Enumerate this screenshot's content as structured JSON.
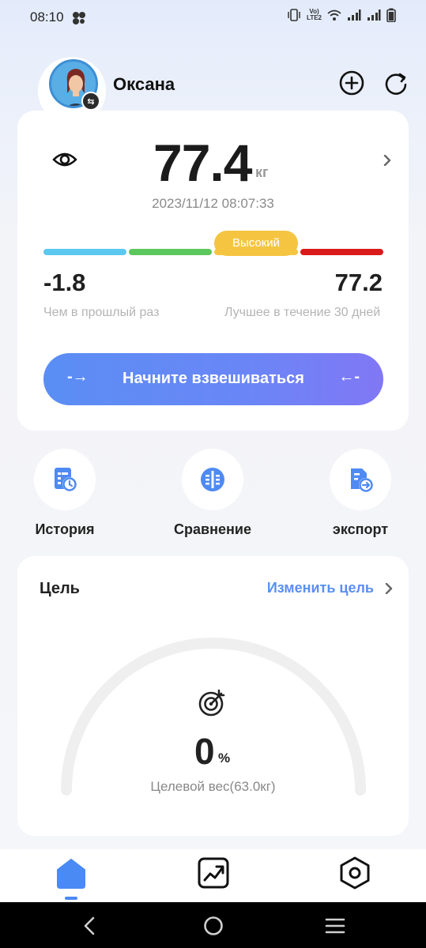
{
  "status_bar": {
    "time": "08:10",
    "network_label_top": "Vo)",
    "network_label_bottom": "LTE2",
    "icons": [
      "app-cluster-icon",
      "vibrate-icon",
      "wifi-icon",
      "signal-icon",
      "signal-icon",
      "battery-icon"
    ]
  },
  "header": {
    "user_name": "Оксана",
    "add_icon": "plus-circle-icon",
    "sync_icon": "refresh-icon"
  },
  "weight": {
    "value": "77.4",
    "unit": "кг",
    "datetime": "2023/11/12 08:07:33",
    "level_badge": "Высокий",
    "level_colors": [
      "#5cc8ee",
      "#5cc75c",
      "#f5c542",
      "#d91b1b"
    ],
    "delta_value": "-1.8",
    "delta_caption": "Чем в прошлый раз",
    "best_value": "77.2",
    "best_caption": "Лучшее в течение 30 дней",
    "start_button": "Начните взвешиваться",
    "arrow_left": "-→",
    "arrow_right": "←-"
  },
  "actions": [
    {
      "label": "История",
      "icon": "history-icon"
    },
    {
      "label": "Сравнение",
      "icon": "compare-icon"
    },
    {
      "label": "экспорт",
      "icon": "export-icon"
    }
  ],
  "goal": {
    "title": "Цель",
    "change_link": "Изменить цель",
    "progress_percent": "0",
    "percent_sign": "%",
    "target_text": "Целевой вес(63.0кг)"
  },
  "bottom_nav": {
    "items": [
      "home-icon",
      "trend-chart-icon",
      "settings-icon"
    ],
    "active": "home-icon"
  },
  "colors": {
    "accent": "#5a8ff0",
    "button_gradient_start": "#5a8ef4",
    "button_gradient_end": "#8177f5",
    "text_secondary": "#8a8a8a"
  }
}
